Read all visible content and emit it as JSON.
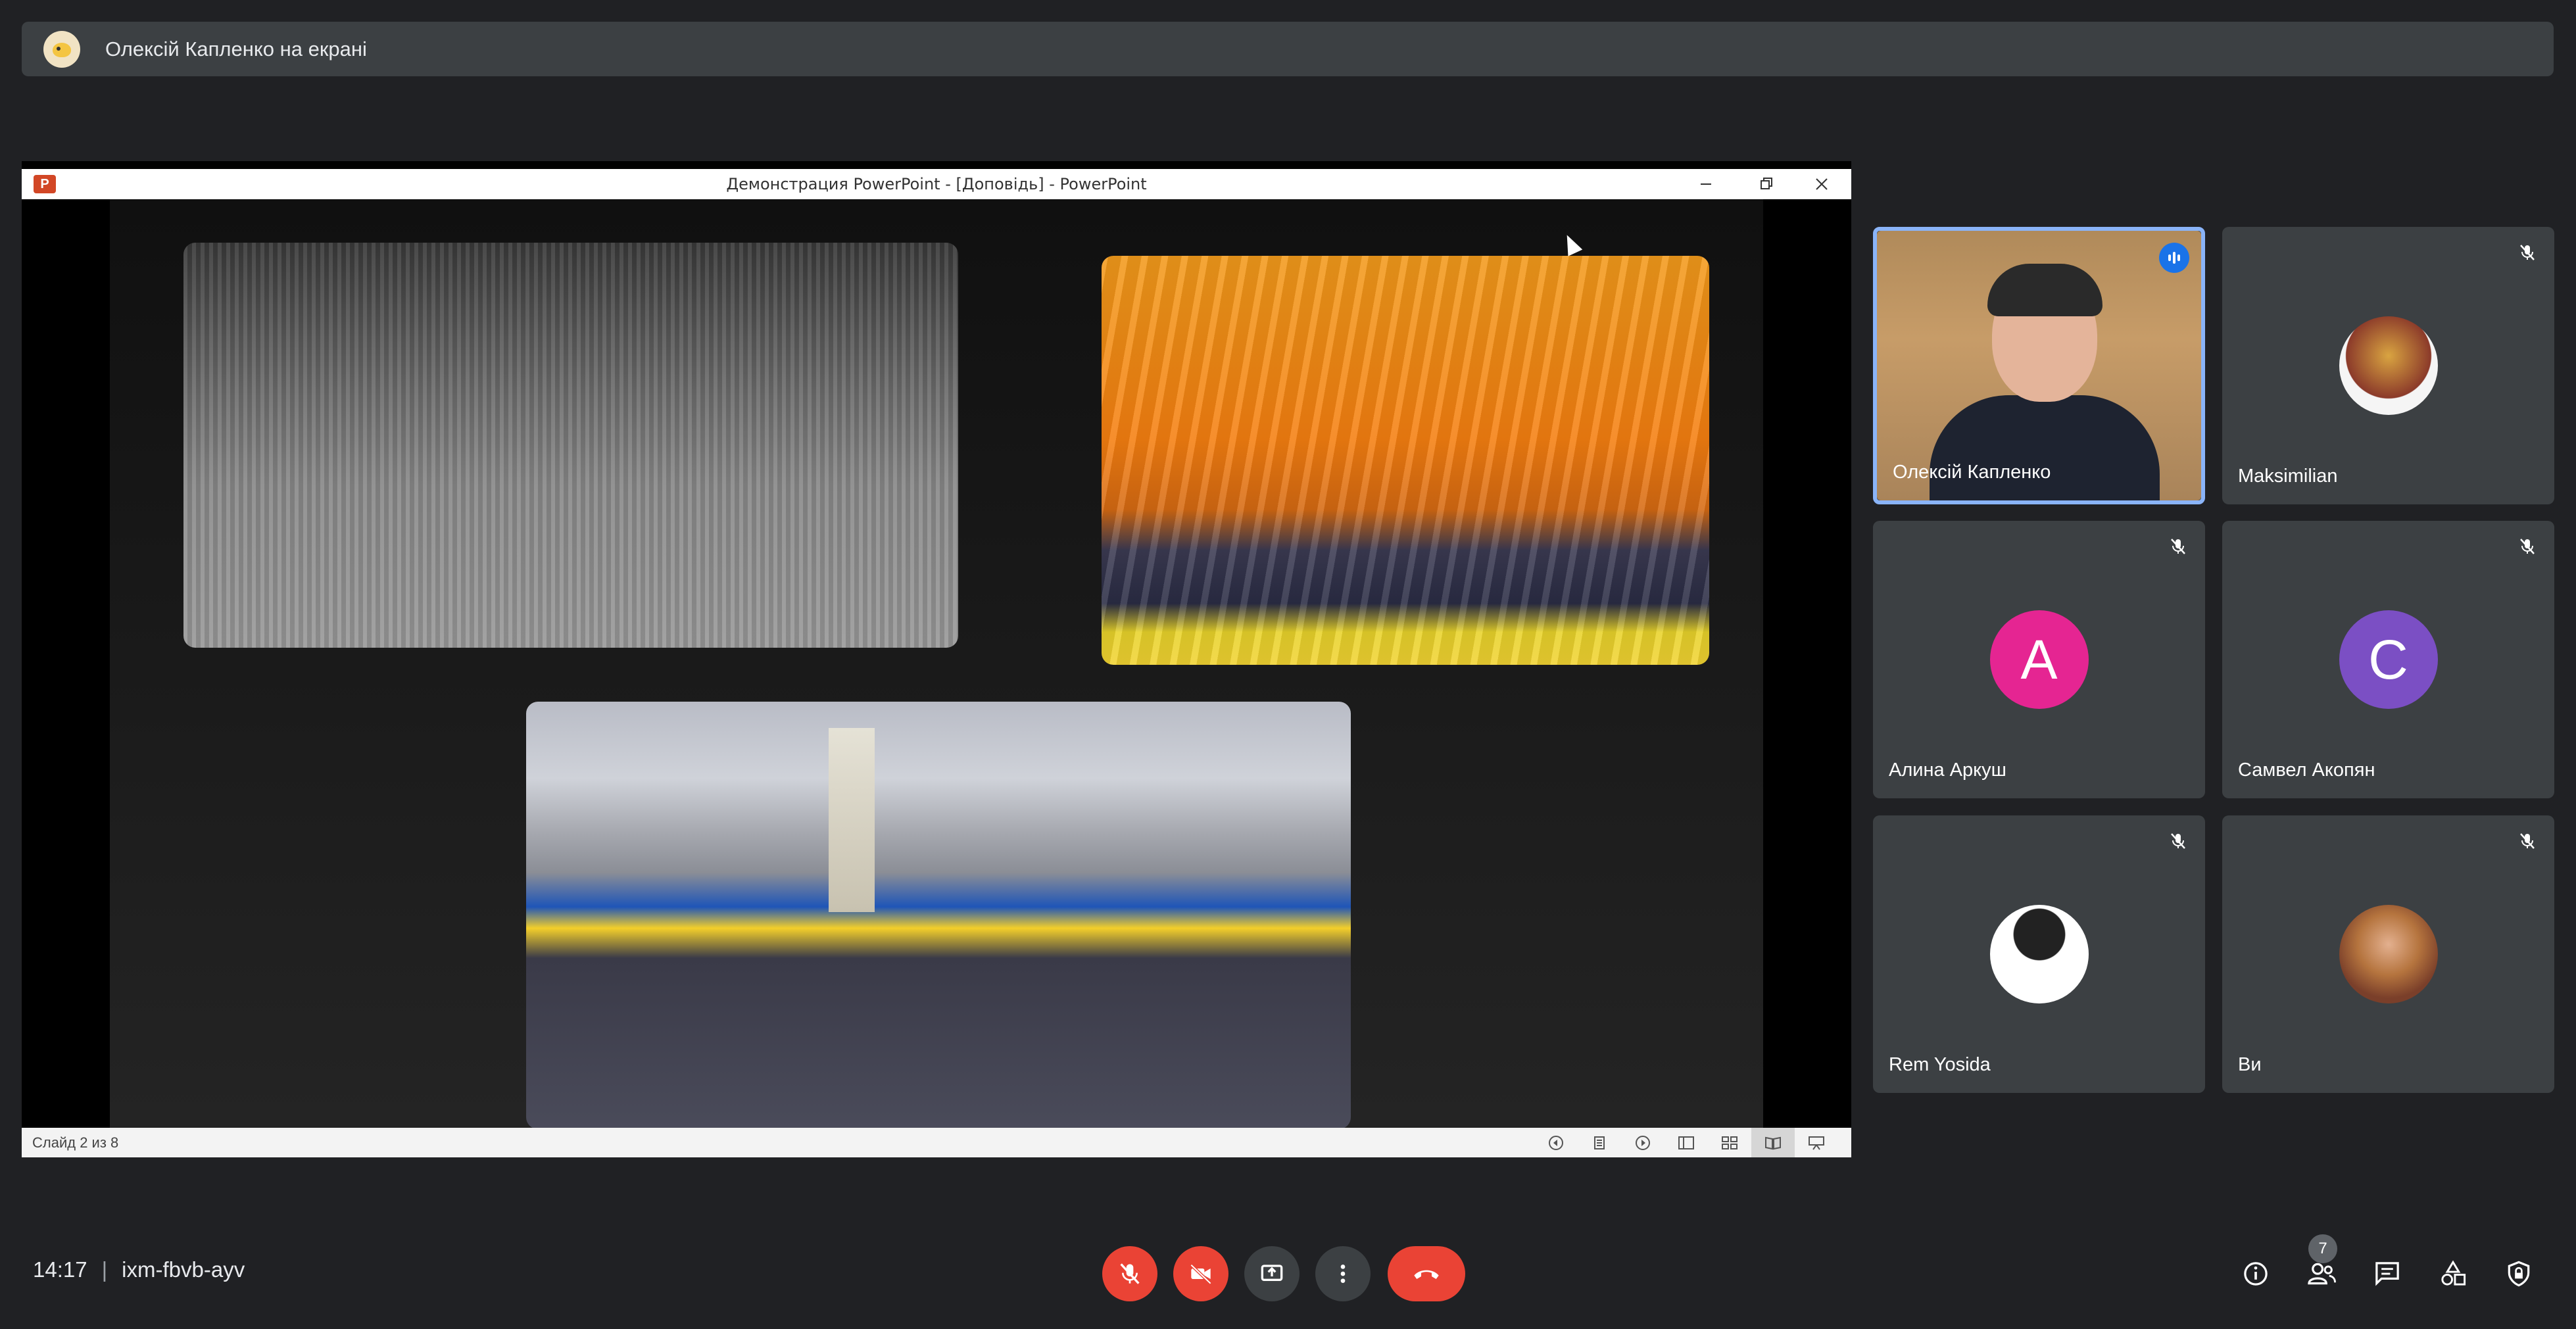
{
  "banner": {
    "presenter_text": "Олексій Капленко на екрані"
  },
  "ppt": {
    "title": "Демонстрация PowerPoint - [Доповідь] - PowerPoint",
    "app_letter": "P",
    "slide_counter": "Слайд 2 из 8"
  },
  "participants": [
    {
      "name": "Олексій Капленко",
      "speaking": true,
      "type": "video"
    },
    {
      "name": "Maksimilian",
      "muted": true,
      "type": "avatar-image"
    },
    {
      "name": "Алина Аркуш",
      "muted": true,
      "initial": "A",
      "color": "#e52592"
    },
    {
      "name": "Самвел Акопян",
      "muted": true,
      "initial": "C",
      "color": "#7b4fc4"
    },
    {
      "name": "Rem Yosida",
      "muted": true,
      "type": "avatar-image"
    },
    {
      "name": "Ви",
      "muted": true,
      "type": "avatar-image"
    }
  ],
  "bottom": {
    "time": "14:17",
    "separator": "|",
    "meeting_code": "ixm-fbvb-ayv",
    "people_count": "7"
  },
  "colors": {
    "background": "#202124",
    "tile": "#3c4043",
    "red": "#ea4335",
    "accent": "#8ab4f8"
  }
}
